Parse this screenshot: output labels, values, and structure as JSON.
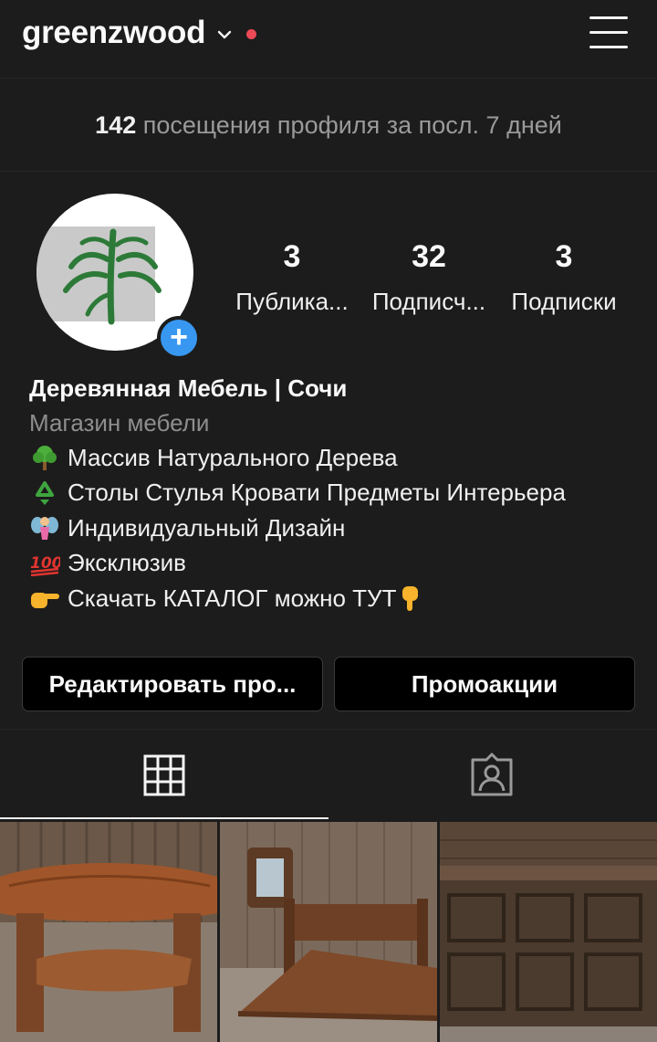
{
  "header": {
    "username": "greenzwood",
    "accent_dot_color": "#ed4956",
    "icons": [
      "chevron-down-icon",
      "hamburger-menu-icon"
    ]
  },
  "insights": {
    "count": "142",
    "text": " посещения профиля за посл. 7 дней"
  },
  "stats": [
    {
      "value": "3",
      "label": "Публика..."
    },
    {
      "value": "32",
      "label": "Подписч..."
    },
    {
      "value": "3",
      "label": "Подписки"
    }
  ],
  "bio": {
    "name": "Деревянная Мебель | Сочи",
    "category": "Магазин мебели",
    "lines": [
      {
        "icon": "tree-emoji",
        "text": "Массив Натурального Дерева"
      },
      {
        "icon": "recycle-emoji",
        "text": "Столы Стулья Кровати Предметы Интерьера"
      },
      {
        "icon": "fairy-emoji",
        "text": "Индивидуальный Дизайн"
      },
      {
        "icon": "hundred-points-emoji",
        "text": "Эксклюзив"
      },
      {
        "icon": "pointing-right-emoji",
        "text": "Скачать КАТАЛОГ можно ТУТ"
      }
    ]
  },
  "buttons": {
    "edit": "Редактировать про...",
    "promo": "Промоакции"
  },
  "tabs": [
    {
      "icon": "grid-icon",
      "active": true
    },
    {
      "icon": "tagged-person-icon",
      "active": false
    }
  ],
  "posts": [
    {
      "subject": "wooden coffee table photo"
    },
    {
      "subject": "wooden bed photo"
    },
    {
      "subject": "wooden bar counter photo"
    }
  ],
  "colors": {
    "background": "#1c1c1c",
    "accent_blue": "#3897f0",
    "muted_text": "#8e8e8e"
  }
}
